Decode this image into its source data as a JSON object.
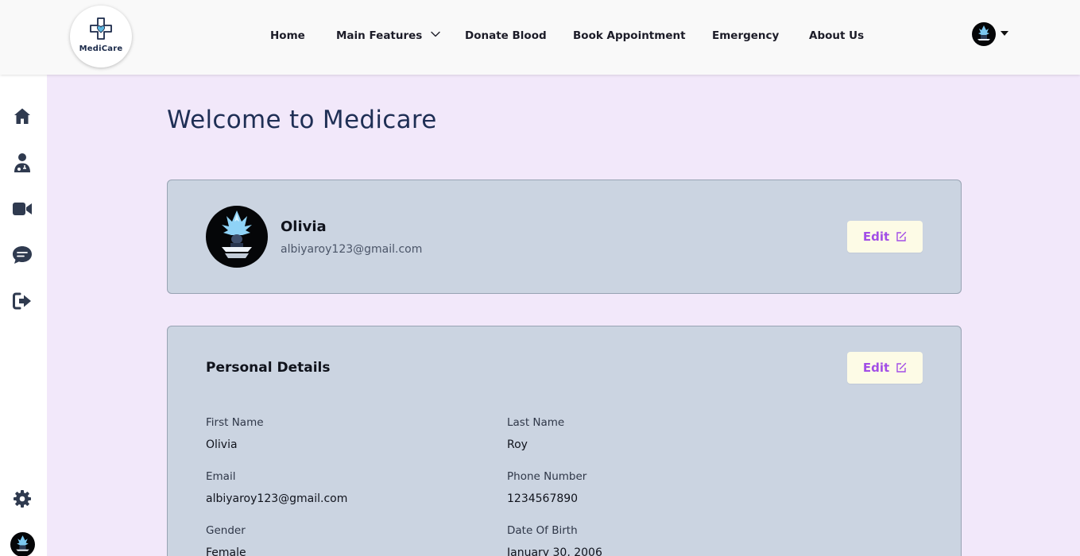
{
  "logo": {
    "text": "MediCare"
  },
  "nav": {
    "items": [
      {
        "label": "Home"
      },
      {
        "label": "Main Features"
      },
      {
        "label": "Donate Blood"
      },
      {
        "label": "Book Appointment"
      },
      {
        "label": "Emergency"
      },
      {
        "label": "About Us"
      }
    ]
  },
  "sidebar": {
    "icons": [
      "home-icon",
      "doctor-icon",
      "video-icon",
      "chat-icon",
      "logout-icon",
      "settings-icon"
    ]
  },
  "page": {
    "title": "Welcome to Medicare"
  },
  "profile": {
    "name": "Olivia",
    "email": "albiyaroy123@gmail.com",
    "edit_label": "Edit"
  },
  "details": {
    "title": "Personal Details",
    "edit_label": "Edit",
    "first_name": {
      "label": "First Name",
      "value": "Olivia"
    },
    "last_name": {
      "label": "Last Name",
      "value": "Roy"
    },
    "email": {
      "label": "Email",
      "value": "albiyaroy123@gmail.com"
    },
    "phone": {
      "label": "Phone Number",
      "value": "1234567890"
    },
    "gender": {
      "label": "Gender",
      "value": "Female"
    },
    "dob": {
      "label": "Date Of Birth",
      "value": "January 30, 2006"
    }
  },
  "colors": {
    "background": "#f2e8fa",
    "card": "#cbd4e1",
    "edit_button_bg": "#fdfbe6",
    "edit_button_text": "#a24ee6",
    "title": "#1f2f55"
  }
}
